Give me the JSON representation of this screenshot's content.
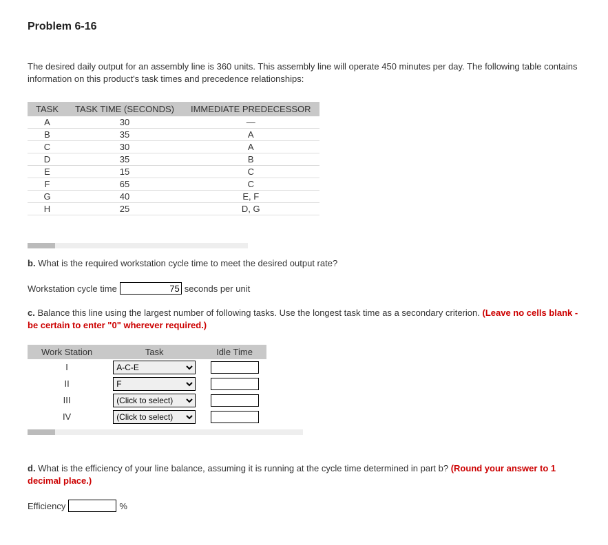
{
  "title": "Problem 6-16",
  "intro": "The desired daily output for an assembly line is 360 units. This assembly line will operate 450 minutes per day. The following table contains information on this product's task times and precedence relationships:",
  "task_table": {
    "headers": [
      "TASK",
      "TASK TIME (SECONDS)",
      "IMMEDIATE PREDECESSOR"
    ],
    "rows": [
      {
        "task": "A",
        "time": "30",
        "pred": "—"
      },
      {
        "task": "B",
        "time": "35",
        "pred": "A"
      },
      {
        "task": "C",
        "time": "30",
        "pred": "A"
      },
      {
        "task": "D",
        "time": "35",
        "pred": "B"
      },
      {
        "task": "E",
        "time": "15",
        "pred": "C"
      },
      {
        "task": "F",
        "time": "65",
        "pred": "C"
      },
      {
        "task": "G",
        "time": "40",
        "pred": "E, F"
      },
      {
        "task": "H",
        "time": "25",
        "pred": "D, G"
      }
    ]
  },
  "part_b": {
    "prompt_label": "b.",
    "prompt_text": "What is the required workstation cycle time to meet the desired output rate?",
    "field_label": "Workstation cycle time",
    "value": "75",
    "suffix": "seconds per unit"
  },
  "part_c": {
    "prompt_label": "c.",
    "prompt_text": "Balance this line using the largest number of following tasks. Use the longest task time as a secondary criterion.",
    "warn": "(Leave no cells blank - be certain to enter \"0\" wherever required.)",
    "headers": [
      "Work Station",
      "Task",
      "Idle Time"
    ],
    "rows": [
      {
        "ws": "I",
        "task_selected": "A-C-E",
        "idle": ""
      },
      {
        "ws": "II",
        "task_selected": "F",
        "idle": ""
      },
      {
        "ws": "III",
        "task_selected": "(Click to select)",
        "idle": ""
      },
      {
        "ws": "IV",
        "task_selected": "(Click to select)",
        "idle": ""
      }
    ],
    "select_placeholder": "(Click to select)"
  },
  "part_d": {
    "prompt_label": "d.",
    "prompt_text": "What is the efficiency of your line balance, assuming it is running at the cycle time determined in part b?",
    "warn": "(Round your answer to 1 decimal place.)",
    "field_label": "Efficiency",
    "value": "",
    "suffix": "%"
  }
}
